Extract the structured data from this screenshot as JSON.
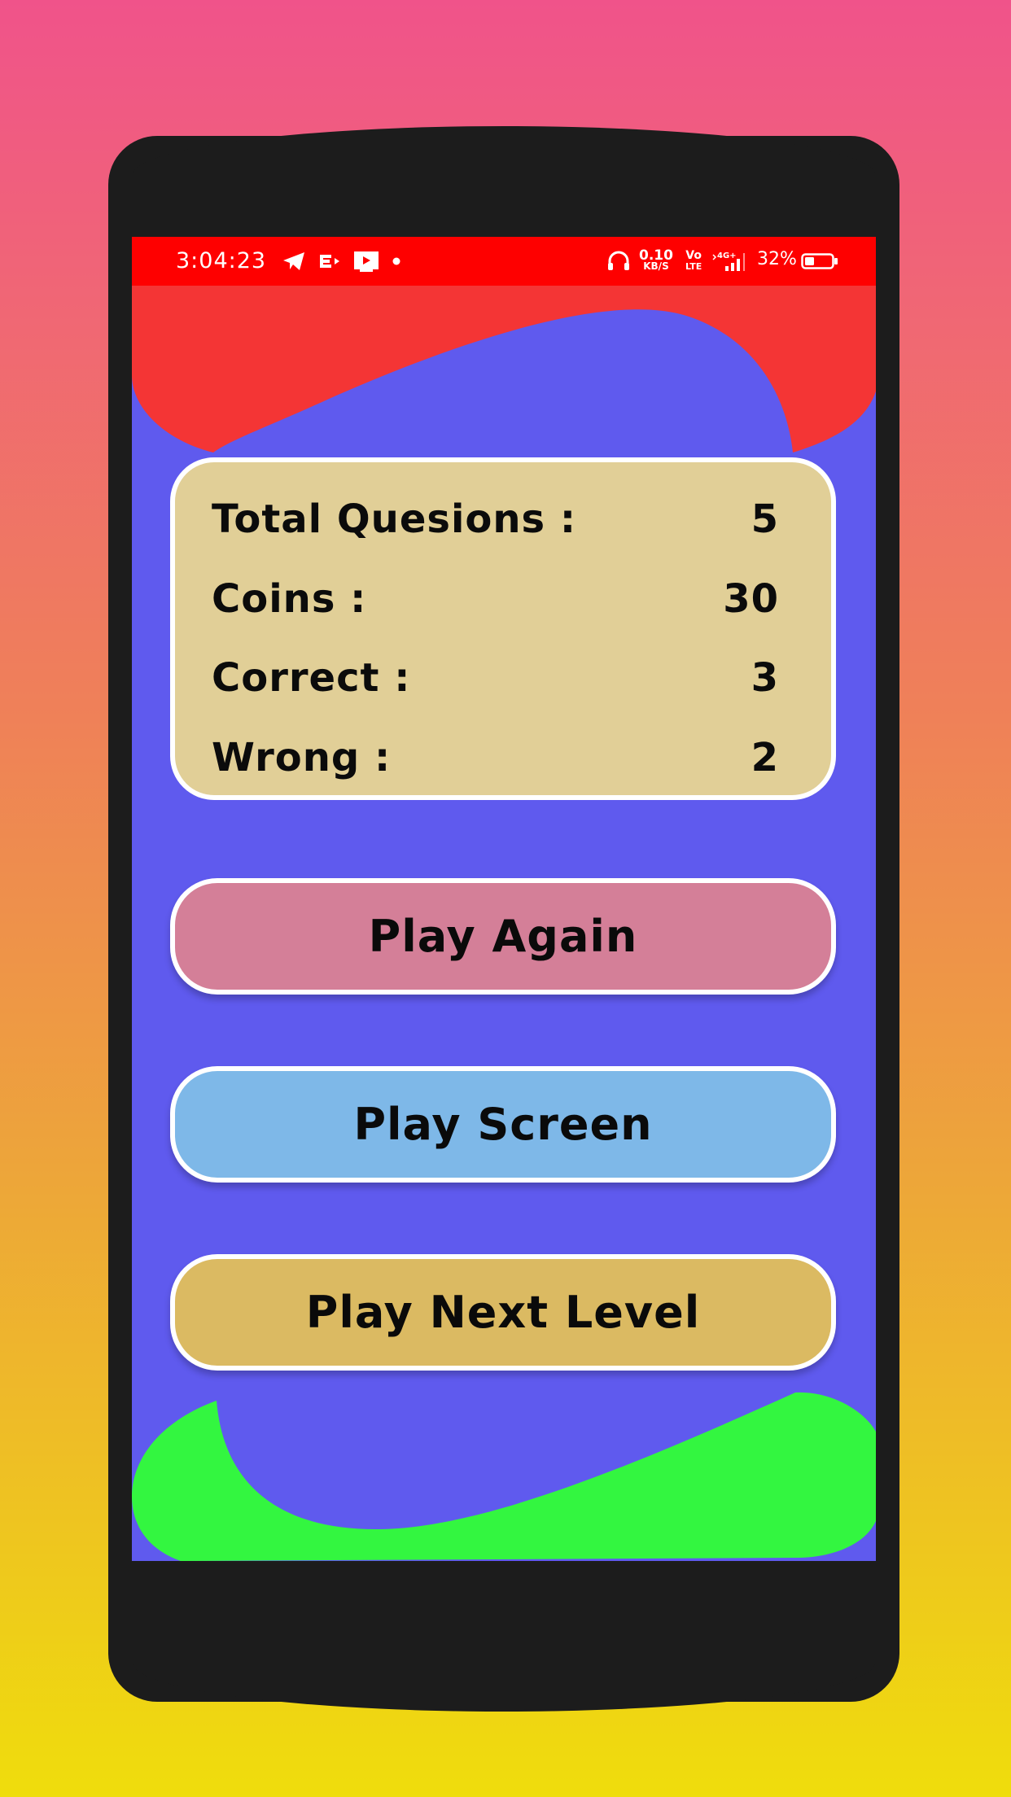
{
  "status_bar": {
    "time": "3:04:23",
    "network_speed_value": "0.10",
    "network_speed_unit": "KB/S",
    "volte_top": "Vo",
    "volte_bottom": "LTE",
    "network_type": "4G+",
    "battery_percent": "32%"
  },
  "stats": [
    {
      "label": "Total Quesions :",
      "value": "5"
    },
    {
      "label": "Coins :",
      "value": "30"
    },
    {
      "label": "Correct :",
      "value": "3"
    },
    {
      "label": "Wrong :",
      "value": "2"
    }
  ],
  "buttons": {
    "play_again": "Play Again",
    "play_screen": "Play Screen",
    "play_next_level": "Play Next Level"
  },
  "colors": {
    "status_bar": "#fe0000",
    "screen_background": "#5f5aee",
    "top_blob": "#f43535",
    "bottom_blob": "#33f640",
    "stats_card": "#e1cf97",
    "play_again": "#d47f98",
    "play_screen": "#7eb8e8",
    "play_next_level": "#dbba62"
  }
}
